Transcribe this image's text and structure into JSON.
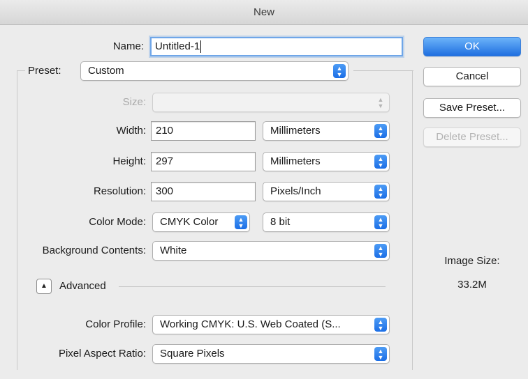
{
  "window": {
    "title": "New"
  },
  "name": {
    "label": "Name:",
    "value": "Untitled-1"
  },
  "preset": {
    "label": "Preset:",
    "value": "Custom"
  },
  "size": {
    "label": "Size:",
    "value": ""
  },
  "width": {
    "label": "Width:",
    "value": "210",
    "unit": "Millimeters"
  },
  "height": {
    "label": "Height:",
    "value": "297",
    "unit": "Millimeters"
  },
  "resolution": {
    "label": "Resolution:",
    "value": "300",
    "unit": "Pixels/Inch"
  },
  "color_mode": {
    "label": "Color Mode:",
    "value": "CMYK Color",
    "depth": "8 bit"
  },
  "background": {
    "label": "Background Contents:",
    "value": "White"
  },
  "advanced": {
    "label": "Advanced"
  },
  "color_profile": {
    "label": "Color Profile:",
    "value": "Working CMYK:  U.S. Web Coated (S..."
  },
  "pixel_aspect": {
    "label": "Pixel Aspect Ratio:",
    "value": "Square Pixels"
  },
  "buttons": {
    "ok": "OK",
    "cancel": "Cancel",
    "save_preset": "Save Preset...",
    "delete_preset": "Delete Preset..."
  },
  "image_size": {
    "label": "Image Size:",
    "value": "33.2M"
  },
  "icons": {
    "popup_arrows": "⌃⌄",
    "disclosure": "▲"
  },
  "colors": {
    "accent": "#1f6fe0",
    "focus_ring": "#6fa6e8"
  }
}
